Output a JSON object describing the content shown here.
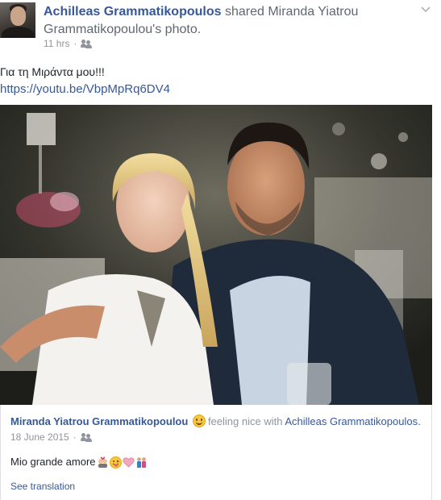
{
  "header": {
    "actor": "Achilleas Grammatikopoulos",
    "verb": "shared",
    "target": "Miranda Yiatrou Grammatikopoulou's photo.",
    "time": "11 hrs",
    "audience_icon": "friends-icon",
    "menu_icon": "chevron-down-icon"
  },
  "post": {
    "message": "Για τη Μιράντα μου!!!",
    "link": "https://youtu.be/VbpMpRq6DV4"
  },
  "shared": {
    "owner": "Miranda Yiatrou Grammatikopoulou",
    "feeling": "feeling nice with",
    "tagged": "Achilleas Grammatikopoulos.",
    "date": "18 June 2015",
    "audience_icon": "friends-icon",
    "text": "Mio grande amore",
    "emojis": [
      "couple-with-heart-emoji",
      "tongue-out-emoji",
      "pink-heart-emoji",
      "couple-emoji"
    ],
    "see_translation": "See translation"
  },
  "colors": {
    "link": "#365899",
    "meta": "#90949c",
    "text": "#1d2129"
  }
}
